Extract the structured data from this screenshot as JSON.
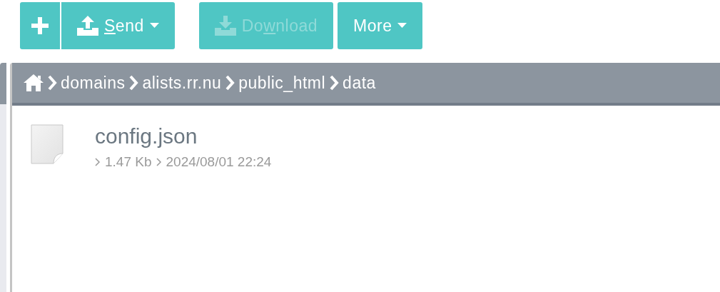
{
  "toolbar": [
    {
      "kind": "add",
      "disabled": false,
      "caret": false
    },
    {
      "kind": "upload",
      "key": "S",
      "after": "end",
      "disabled": false,
      "caret": true
    },
    {
      "kind": "download",
      "before": "Do",
      "key": "w",
      "after": "nload",
      "disabled": true,
      "caret": false
    },
    {
      "kind": "menu",
      "before": "More",
      "disabled": false,
      "caret": true
    }
  ],
  "breadcrumb": [
    "domains",
    "alists.rr.nu",
    "public_html",
    "data"
  ],
  "files": [
    {
      "name": "config.json",
      "size": "1.47 Kb",
      "modified": "2024/08/01 22:24"
    }
  ]
}
